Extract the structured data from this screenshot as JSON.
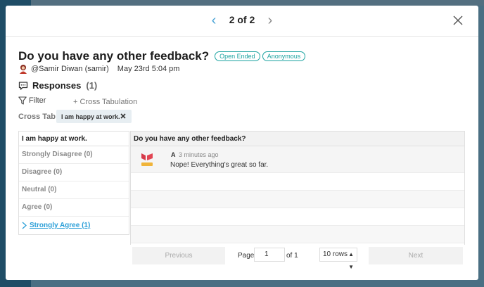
{
  "header": {
    "page_indicator": "2 of 2",
    "prev_icon": "chevron-left-icon",
    "next_icon": "chevron-right-icon",
    "close_icon": "close-icon"
  },
  "question": {
    "title": "Do you have any other feedback?",
    "badges": [
      "Open Ended",
      "Anonymous"
    ],
    "author": "@Samir Diwan (samir)",
    "date": "May 23rd 5:04 pm"
  },
  "responses": {
    "label": "Responses",
    "count": "(1)"
  },
  "filter": {
    "label": "Filter",
    "cross_tab_button": "+ Cross Tabulation",
    "cross_tab_label": "Cross Tab:",
    "chip": "I am happy at work."
  },
  "left_table": {
    "header": "I am happy at work.",
    "rows": [
      "Strongly Disagree (0)",
      "Disagree (0)",
      "Neutral (0)",
      "Agree (0)"
    ],
    "expanded_row": "Strongly Agree (1)"
  },
  "right_panel": {
    "header": "Do you have any other feedback?",
    "response": {
      "user": "A",
      "time": "3 minutes ago",
      "text": "Nope! Everything's great so far."
    }
  },
  "pager": {
    "previous": "Previous",
    "page_label": "Page",
    "page_value": "1",
    "of": "of 1",
    "rows": "10 rows",
    "next": "Next"
  },
  "colors": {
    "accent": "#4aa3d6",
    "badge": "#1ba3a0",
    "link": "#2b9fd8"
  }
}
